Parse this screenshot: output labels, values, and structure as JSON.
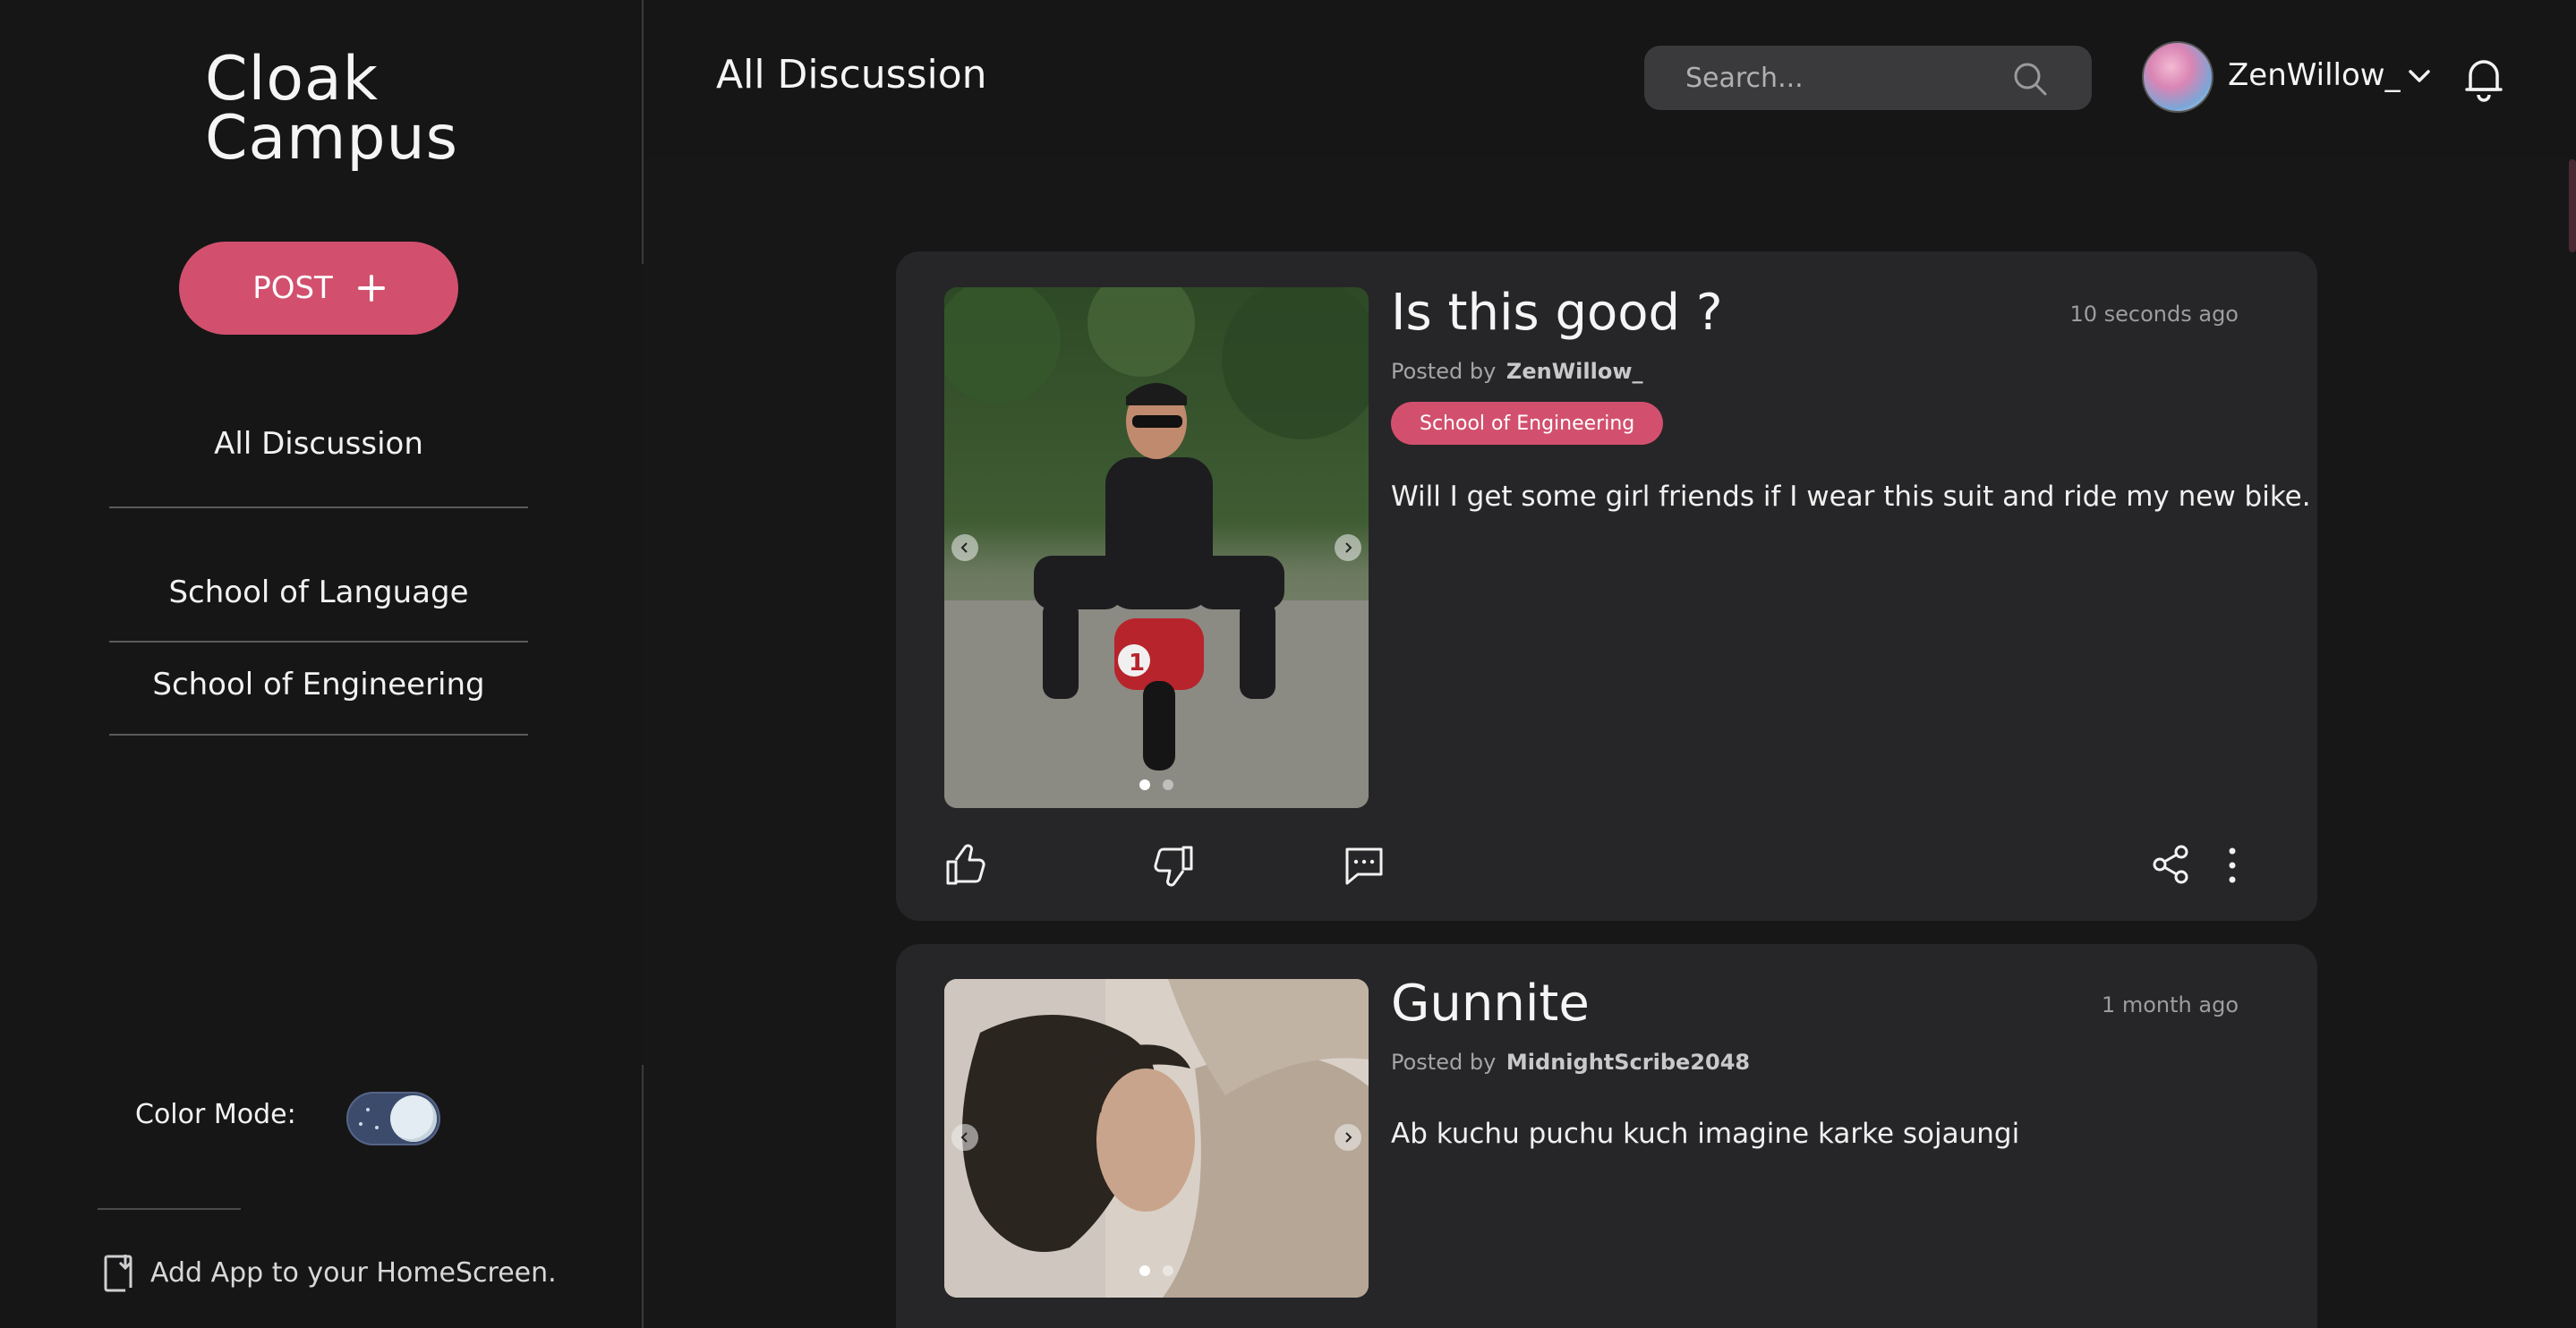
{
  "app": {
    "logo_line1": "Cloak",
    "logo_line2": "Campus"
  },
  "colors": {
    "accent": "#d2506e",
    "background": "#171718",
    "card": "#262628",
    "search_bg": "#3a3a3d"
  },
  "sidebar": {
    "post_button_label": "POST",
    "items": [
      {
        "label": "All Discussion"
      },
      {
        "label": "School of Language"
      },
      {
        "label": "School of Engineering"
      }
    ],
    "color_mode_label": "Color Mode:",
    "color_mode_state": "dark",
    "add_app_label": "Add App to your HomeScreen."
  },
  "header": {
    "title": "All Discussion",
    "search_placeholder": "Search...",
    "username": "ZenWillow_"
  },
  "posts": [
    {
      "title": "Is this good ?",
      "time": "10 seconds ago",
      "posted_by_prefix": "Posted by",
      "author": "ZenWillow_",
      "tag": "School of Engineering",
      "body": "Will I get some girl friends if I wear this suit and ride my new bike.",
      "image_desc_icon": "photo-man-on-minibike",
      "carousel_count": 2,
      "carousel_active": 1
    },
    {
      "title": "Gunnite",
      "time": "1 month ago",
      "posted_by_prefix": "Posted by",
      "author": "MidnightScribe2048",
      "body": "Ab kuchu puchu kuch imagine karke sojaungi",
      "image_desc_icon": "photo-person-lying-in-bed",
      "carousel_count": 2,
      "carousel_active": 1
    }
  ]
}
